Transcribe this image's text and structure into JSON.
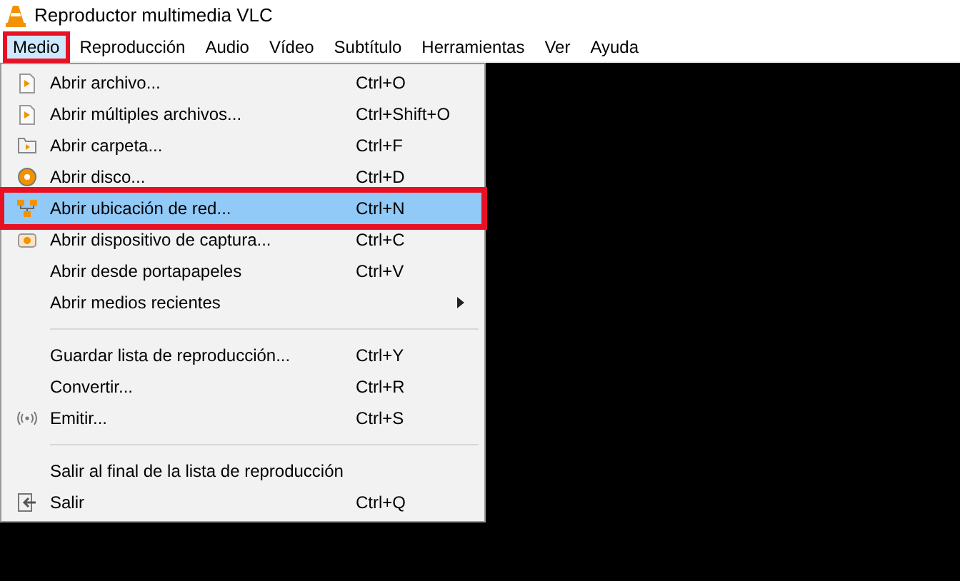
{
  "window": {
    "title": "Reproductor multimedia VLC"
  },
  "menu_bar": [
    {
      "label": "Medio",
      "selected": true,
      "marked": true
    },
    {
      "label": "Reproducción",
      "selected": false,
      "marked": false
    },
    {
      "label": "Audio",
      "selected": false,
      "marked": false
    },
    {
      "label": "Vídeo",
      "selected": false,
      "marked": false
    },
    {
      "label": "Subtítulo",
      "selected": false,
      "marked": false
    },
    {
      "label": "Herramientas",
      "selected": false,
      "marked": false
    },
    {
      "label": "Ver",
      "selected": false,
      "marked": false
    },
    {
      "label": "Ayuda",
      "selected": false,
      "marked": false
    }
  ],
  "menu": [
    {
      "kind": "item",
      "label": "Abrir archivo...",
      "shortcut": "Ctrl+O",
      "selected": false,
      "marked": false
    },
    {
      "kind": "item",
      "label": "Abrir múltiples archivos...",
      "shortcut": "Ctrl+Shift+O",
      "selected": false,
      "marked": false
    },
    {
      "kind": "item",
      "label": "Abrir carpeta...",
      "shortcut": "Ctrl+F",
      "selected": false,
      "marked": false
    },
    {
      "kind": "item",
      "label": "Abrir disco...",
      "shortcut": "Ctrl+D",
      "selected": false,
      "marked": false
    },
    {
      "kind": "item",
      "label": "Abrir ubicación de red...",
      "shortcut": "Ctrl+N",
      "selected": true,
      "marked": true
    },
    {
      "kind": "item",
      "label": "Abrir dispositivo de captura...",
      "shortcut": "Ctrl+C",
      "selected": false,
      "marked": false
    },
    {
      "kind": "item",
      "label": "Abrir desde portapapeles",
      "shortcut": "Ctrl+V",
      "selected": false,
      "marked": false
    },
    {
      "kind": "submenu",
      "label": "Abrir medios recientes",
      "selected": false,
      "marked": false
    },
    {
      "kind": "separator"
    },
    {
      "kind": "item",
      "label": "Guardar lista de reproducción...",
      "shortcut": "Ctrl+Y",
      "selected": false,
      "marked": false
    },
    {
      "kind": "item",
      "label": "Convertir...",
      "shortcut": "Ctrl+R",
      "selected": false,
      "marked": false
    },
    {
      "kind": "item",
      "label": "Emitir...",
      "shortcut": "Ctrl+S",
      "selected": false,
      "marked": false
    },
    {
      "kind": "separator"
    },
    {
      "kind": "item",
      "label": "Salir al final de la lista de reproducción",
      "selected": false,
      "marked": false
    },
    {
      "kind": "item",
      "label": "Salir",
      "shortcut": "Ctrl+Q",
      "selected": false,
      "marked": false
    }
  ]
}
